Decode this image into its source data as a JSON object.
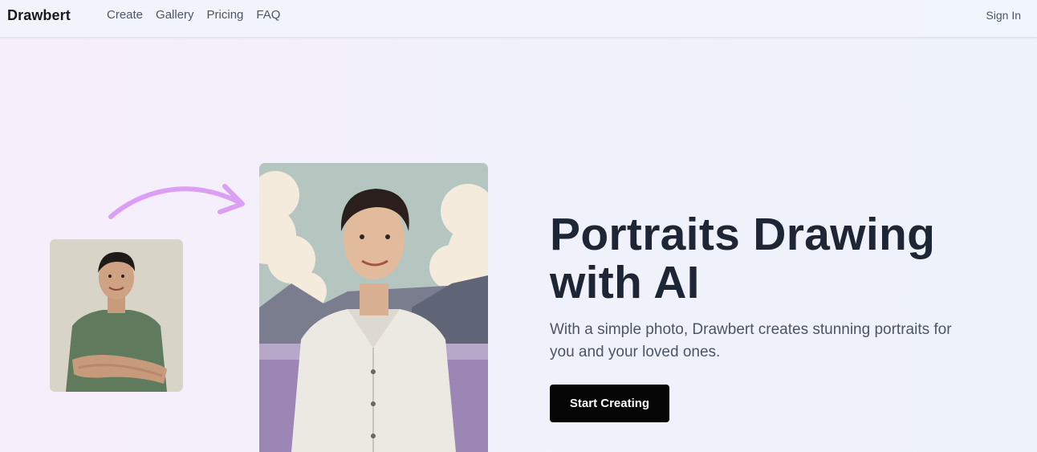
{
  "nav": {
    "brand": "Drawbert",
    "links": [
      "Create",
      "Gallery",
      "Pricing",
      "FAQ"
    ],
    "sign_in": "Sign In"
  },
  "hero": {
    "title_line1": "Portraits Drawing",
    "title_line2": "with AI",
    "subtitle": "With a simple photo, Drawbert creates stunning portraits for you and your loved ones.",
    "cta_label": "Start Creating"
  },
  "colors": {
    "accent_arrow": "#dba0f3",
    "cta_bg": "#050505",
    "title": "#1e2635"
  }
}
